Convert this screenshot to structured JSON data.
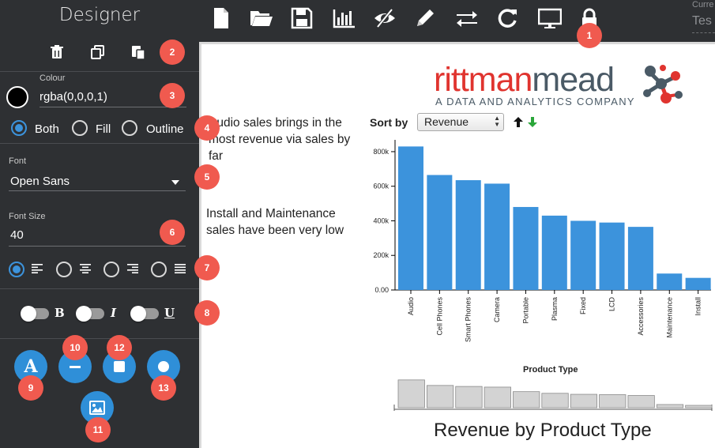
{
  "sidebar": {
    "title": "Designer",
    "colour": {
      "label": "Colour",
      "value": "rgba(0,0,0,1)",
      "swatch": "#000000"
    },
    "fill_mode": {
      "options": [
        "Both",
        "Fill",
        "Outline"
      ],
      "selected": "Both"
    },
    "font": {
      "label": "Font",
      "value": "Open Sans"
    },
    "font_size": {
      "label": "Font Size",
      "value": "40"
    },
    "alignment": {
      "options": [
        "left",
        "center",
        "right",
        "justify"
      ],
      "selected": "left"
    },
    "text_style": {
      "bold": "B",
      "italic": "I",
      "underline": "U"
    },
    "shape_buttons": {
      "text_glyph": "A"
    }
  },
  "toolbar": {
    "current_label": "Curre",
    "current_value": "Tes"
  },
  "badges": [
    "1",
    "2",
    "3",
    "4",
    "5",
    "6",
    "7",
    "8",
    "9",
    "10",
    "11",
    "12",
    "13"
  ],
  "canvas": {
    "logo_part1": "rittman",
    "logo_part2": "mead",
    "logo_tagline": "A DATA AND ANALYTICS COMPANY",
    "note1": "Audio sales brings  in the most revenue via sales by far",
    "note2": "Install and Maintenance sales have been very low",
    "sort_label": "Sort by",
    "sort_value": "Revenue",
    "sub_title": "Product Type",
    "chart_title": "Revenue by Product Type"
  },
  "colors": {
    "accent": "#2f8fd8",
    "badge": "#f05a4f",
    "sidebar_bg": "#2e3033",
    "bar": "#3c93dc"
  },
  "chart_data": {
    "type": "bar",
    "categories": [
      "Audio",
      "Cell Phones",
      "Smart Phones",
      "Camera",
      "Portable",
      "Plasma",
      "Fixed",
      "LCD",
      "Accessories",
      "Maintenance",
      "Install"
    ],
    "values": [
      830000,
      665000,
      635000,
      615000,
      480000,
      430000,
      400000,
      390000,
      365000,
      95000,
      70000
    ],
    "ylim": [
      0,
      850000
    ],
    "yticks": [
      0,
      200000,
      400000,
      600000,
      800000
    ],
    "ytick_labels": [
      "0.00",
      "200k",
      "400k",
      "600k",
      "800k"
    ],
    "bar_color": "#3c93dc",
    "mini_bar_color": "#d3d3d3"
  }
}
